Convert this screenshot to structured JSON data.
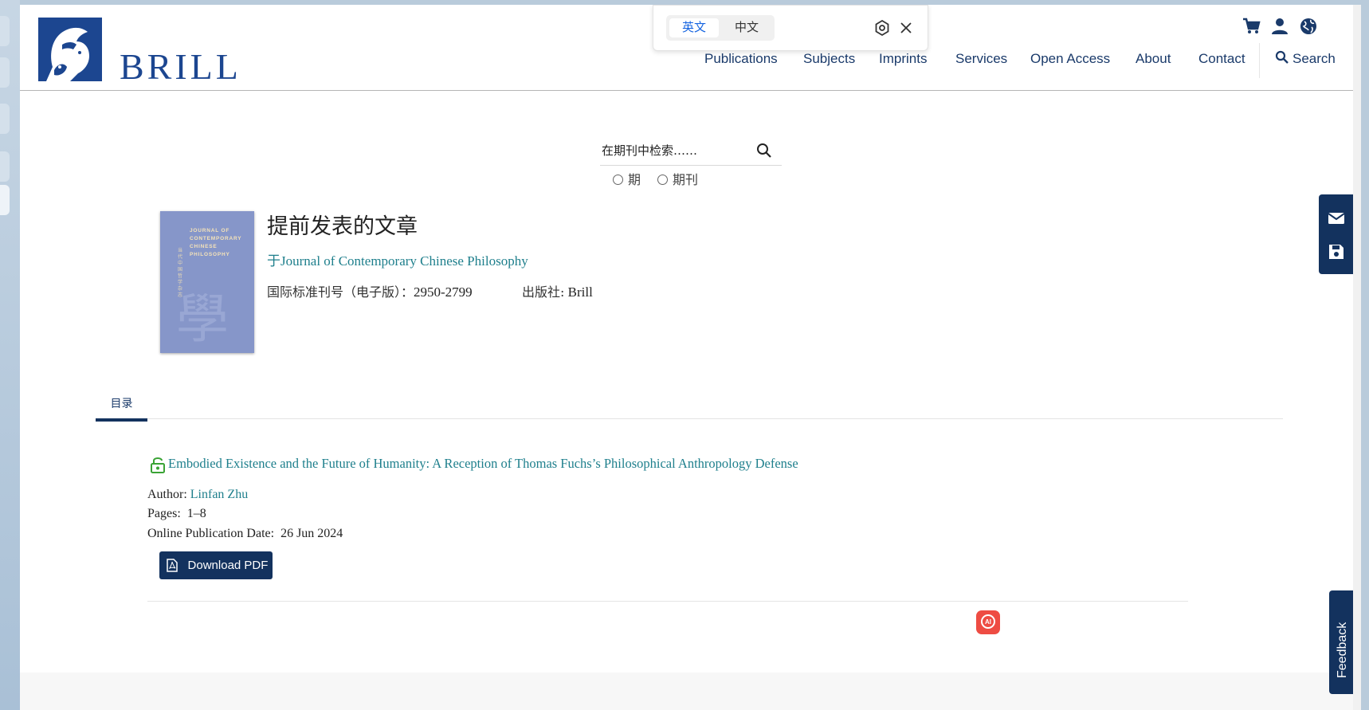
{
  "translate_bar": {
    "lang_en": "英文",
    "lang_zh": "中文"
  },
  "brand": {
    "name": "BRILL"
  },
  "nav": {
    "items": [
      "Publications",
      "Subjects",
      "Imprints",
      "Services",
      "Open Access",
      "About",
      "Contact"
    ],
    "search": "Search"
  },
  "journal_search": {
    "placeholder": "在期刊中检索……",
    "radio_issue": "期",
    "radio_journal": "期刊"
  },
  "journal": {
    "page_title": "提前发表的文章",
    "in_journal": "于Journal of Contemporary Chinese Philosophy",
    "issn_label": "国际标准刊号（电子版）：",
    "issn_value": "2950-2799",
    "publisher_label": "出版社:",
    "publisher_value": "Brill",
    "cover": {
      "title_lines": [
        "JOURNAL OF",
        "CONTEMPORARY",
        "CHINESE",
        "PHILOSOPHY"
      ],
      "chinese_title": "当代中国哲学杂志",
      "big_char": "學"
    }
  },
  "tabs": {
    "toc": "目录"
  },
  "article": {
    "title": "Embodied Existence and the Future of Humanity: A Reception of Thomas Fuchs’s Philosophical Anthropology Defense",
    "author_label": "Author:",
    "author": "Linfan Zhu",
    "pages_label": "Pages:",
    "pages": "1–8",
    "date_label": "Online Publication Date:",
    "date": "26 Jun 2024",
    "download": "Download PDF"
  },
  "feedback": "Feedback",
  "colors": {
    "brand_blue": "#1c4690",
    "navy": "#13325e",
    "teal_link": "#1e7f8c",
    "lock_green": "#3aa335"
  }
}
